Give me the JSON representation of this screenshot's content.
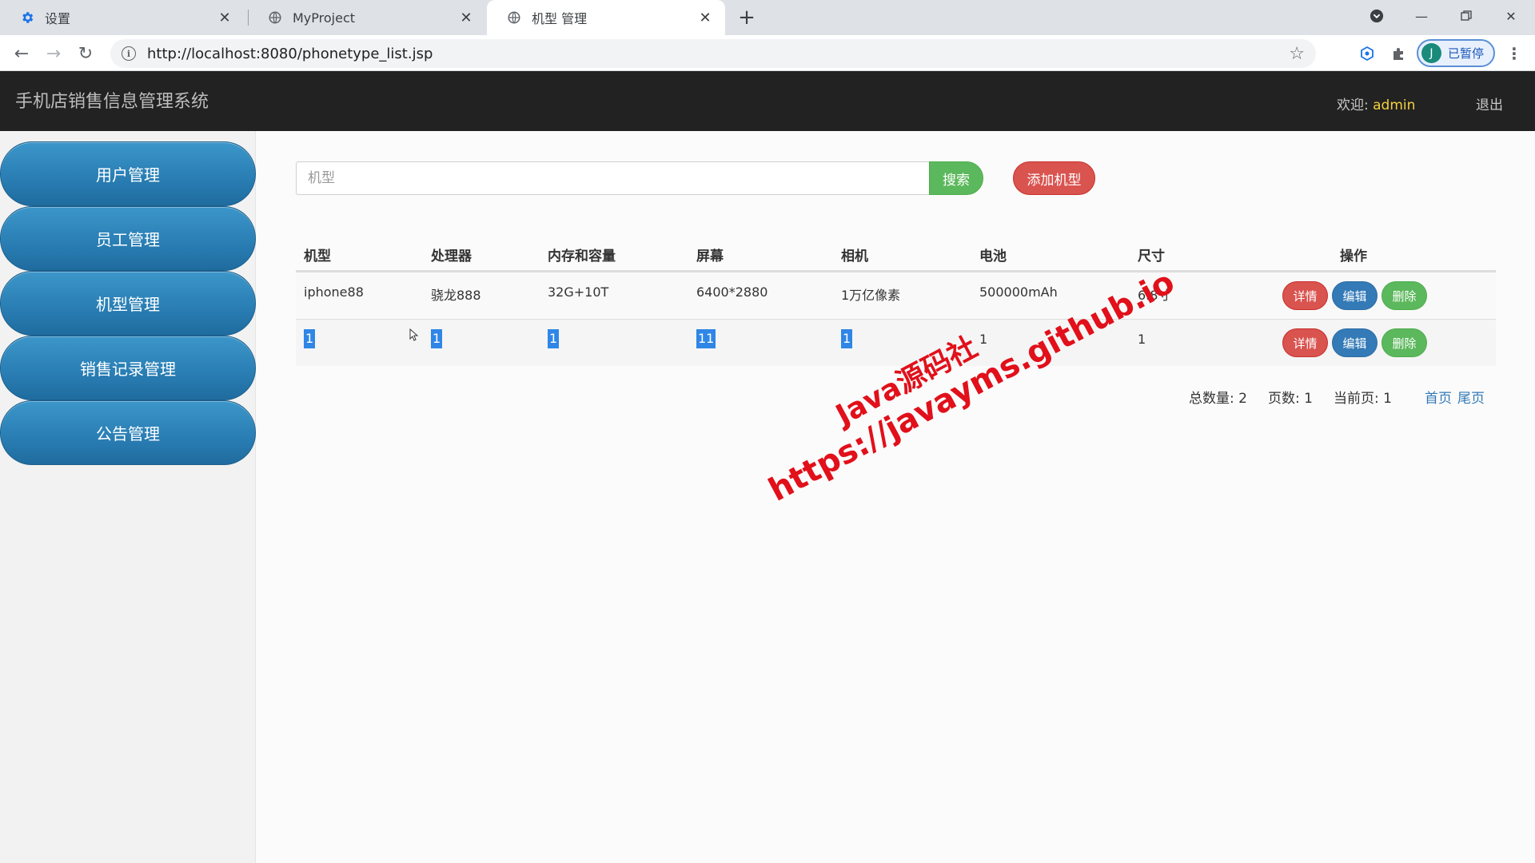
{
  "browser": {
    "tabs": [
      {
        "title": "设置",
        "icon": "gear-icon"
      },
      {
        "title": "MyProject",
        "icon": "globe-icon"
      },
      {
        "title": "机型 管理",
        "icon": "globe-icon",
        "active": true
      }
    ],
    "url": "http://localhost:8080/phonetype_list.jsp",
    "profile_initial": "J",
    "profile_status": "已暂停"
  },
  "header": {
    "title": "手机店销售信息管理系统",
    "welcome_label": "欢迎:",
    "username": "admin",
    "logout": "退出"
  },
  "sidebar": {
    "items": [
      "用户管理",
      "员工管理",
      "机型管理",
      "销售记录管理",
      "公告管理"
    ]
  },
  "search": {
    "placeholder": "机型",
    "button": "搜索",
    "add_button": "添加机型"
  },
  "table": {
    "columns": [
      "机型",
      "处理器",
      "内存和容量",
      "屏幕",
      "相机",
      "电池",
      "尺寸",
      "操作"
    ],
    "rows": [
      [
        "iphone88",
        "骁龙888",
        "32G+10T",
        "6400*2880",
        "1万亿像素",
        "500000mAh",
        "6.8寸"
      ],
      [
        "1",
        "1",
        "1",
        "11",
        "1",
        "1",
        "1"
      ]
    ],
    "actions": {
      "detail": "详情",
      "edit": "编辑",
      "delete": "删除"
    }
  },
  "pagination": {
    "total_label": "总数量:",
    "total": "2",
    "pages_label": "页数:",
    "pages": "1",
    "current_label": "当前页:",
    "current": "1",
    "first": "首页",
    "last": "尾页"
  },
  "watermark": {
    "line1": "Java源码社",
    "line2": "https://javayms.github.io"
  },
  "colors": {
    "header_bg": "#222222",
    "nav_blue": "#2a7fb5",
    "success": "#5cb85c",
    "danger": "#d9534f",
    "primary": "#337ab7",
    "username": "#f4d03f",
    "watermark": "#e1101a"
  }
}
